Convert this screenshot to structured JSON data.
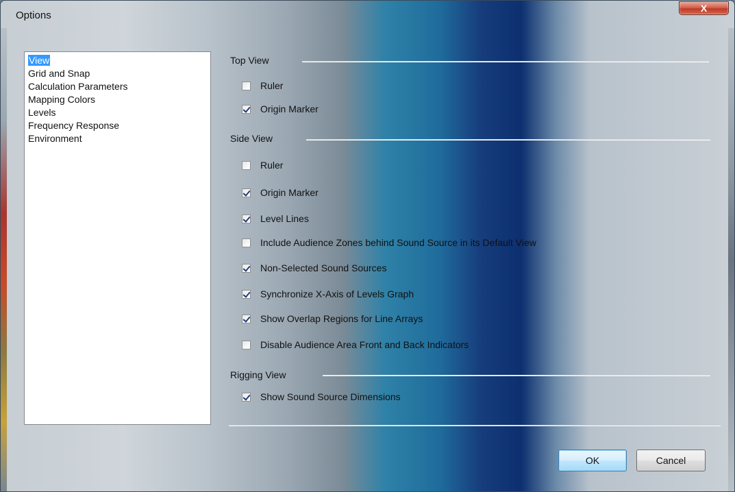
{
  "window": {
    "title": "Options",
    "close_glyph": "X"
  },
  "nav": {
    "items": [
      {
        "label": "View",
        "selected": true
      },
      {
        "label": "Grid and Snap",
        "selected": false
      },
      {
        "label": "Calculation Parameters",
        "selected": false
      },
      {
        "label": "Mapping Colors",
        "selected": false
      },
      {
        "label": "Levels",
        "selected": false
      },
      {
        "label": "Frequency Response",
        "selected": false
      },
      {
        "label": "Environment",
        "selected": false
      }
    ]
  },
  "top_view": {
    "header": "Top View",
    "options": [
      {
        "label": "Ruler",
        "checked": false
      },
      {
        "label": "Origin Marker",
        "checked": true
      }
    ]
  },
  "side_view": {
    "header": "Side View",
    "options": [
      {
        "label": "Ruler",
        "checked": false
      },
      {
        "label": "Origin Marker",
        "checked": true
      },
      {
        "label": "Level Lines",
        "checked": true
      },
      {
        "label": "Include Audience Zones behind Sound Source in its Default View",
        "checked": false
      },
      {
        "label": "Non-Selected Sound Sources",
        "checked": true
      },
      {
        "label": "Synchronize X-Axis of Levels Graph",
        "checked": true
      },
      {
        "label": "Show Overlap Regions for Line Arrays",
        "checked": true
      },
      {
        "label": "Disable Audience Area Front and Back Indicators",
        "checked": false
      }
    ]
  },
  "rigging_view": {
    "header": "Rigging View",
    "options": [
      {
        "label": "Show Sound Source Dimensions",
        "checked": true
      }
    ]
  },
  "buttons": {
    "ok": "OK",
    "cancel": "Cancel"
  },
  "colors": {
    "selection": "#3399ff",
    "close_button": "#c1392a"
  }
}
